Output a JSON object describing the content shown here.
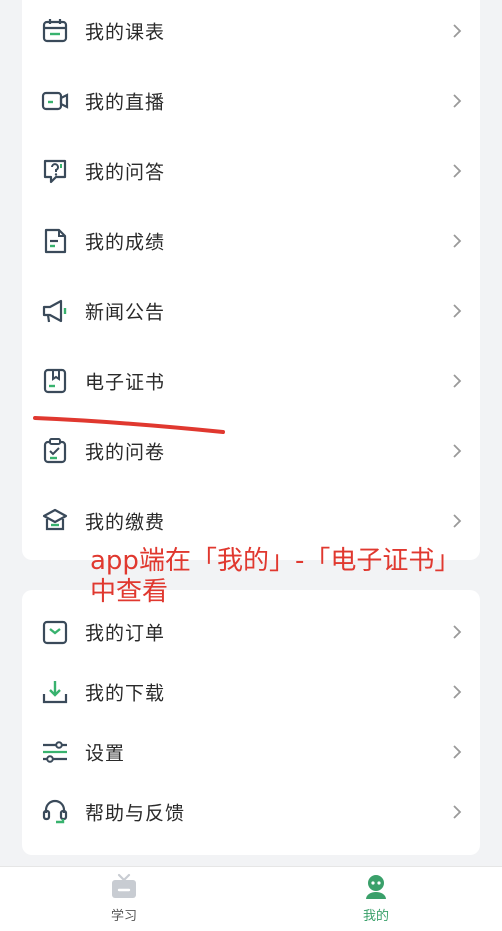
{
  "menu_group_1": [
    {
      "label": "我的课表",
      "icon": "calendar-icon"
    },
    {
      "label": "我的直播",
      "icon": "live-video-icon"
    },
    {
      "label": "我的问答",
      "icon": "question-icon"
    },
    {
      "label": "我的成绩",
      "icon": "score-document-icon"
    },
    {
      "label": "新闻公告",
      "icon": "megaphone-icon"
    },
    {
      "label": "电子证书",
      "icon": "certificate-icon"
    },
    {
      "label": "我的问卷",
      "icon": "questionnaire-icon"
    },
    {
      "label": "我的缴费",
      "icon": "payment-icon"
    }
  ],
  "menu_group_2": [
    {
      "label": "我的订单",
      "icon": "order-icon"
    },
    {
      "label": "我的下载",
      "icon": "download-icon"
    },
    {
      "label": "设置",
      "icon": "settings-sliders-icon"
    },
    {
      "label": "帮助与反馈",
      "icon": "headset-icon"
    }
  ],
  "annotation": {
    "text": "app端在「我的」-「电子证书」中查看",
    "color": "#e0382f"
  },
  "tabbar": {
    "study_label": "学习",
    "mine_label": "我的",
    "active_color": "#3aa06a"
  },
  "colors": {
    "icon_stroke": "#3a4a5a",
    "icon_accent": "#38b26e"
  }
}
